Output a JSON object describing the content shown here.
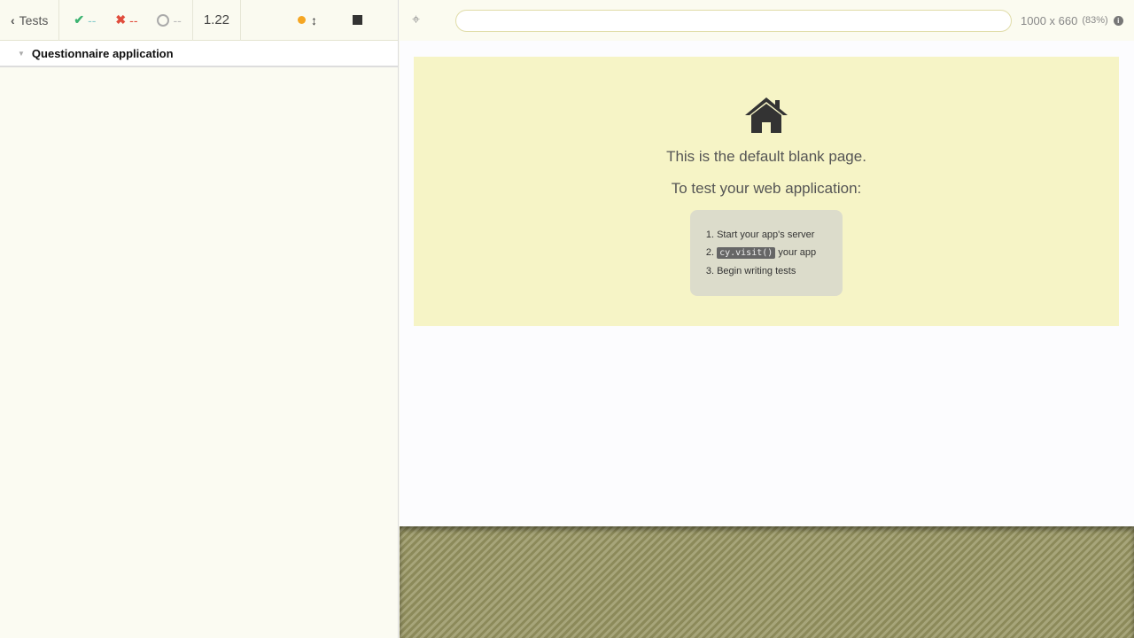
{
  "header": {
    "back_label": "Tests",
    "passed": "--",
    "failed": "--",
    "pending": "--",
    "duration": "1.22"
  },
  "suite": {
    "title": "Questionnaire application"
  },
  "viewport": {
    "size": "1000 x 660",
    "scale": "(83%)",
    "url": ""
  },
  "blank_page": {
    "line1": "This is the default blank page.",
    "line2": "To test your web application:",
    "steps": [
      {
        "num": "1.",
        "text": "Start your app's server"
      },
      {
        "num": "2.",
        "code": "cy.visit()",
        "text": " your app"
      },
      {
        "num": "3.",
        "text": "Begin writing tests"
      }
    ]
  }
}
